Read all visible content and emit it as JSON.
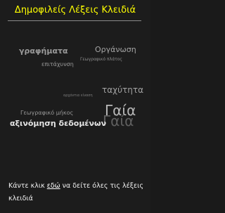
{
  "panel": {
    "title": "Δημοφιλείς Λέξεις Κλειδιά"
  },
  "tag_cloud": [
    {
      "key": "grafimata",
      "label": "γραφήματα"
    },
    {
      "key": "organosi",
      "label": "Οργάνωση"
    },
    {
      "key": "geoplatos",
      "label": "Γεωγραφικό πλάτος"
    },
    {
      "key": "epitaxynsi",
      "label": "επιτάχυνση"
    },
    {
      "key": "taxytita",
      "label": "ταχύτητα"
    },
    {
      "key": "arxontia",
      "label": "αρχόντια είναση"
    },
    {
      "key": "geomikos",
      "label": "Γεωγραφικό μήκος"
    },
    {
      "key": "gaia",
      "label": "Γαία"
    },
    {
      "key": "gaia_ghost",
      "label": "Γαία"
    },
    {
      "key": "axinomisi",
      "label": "αξινόμηση δεδομένων"
    }
  ],
  "footer": {
    "prefix": "Κάντε κλικ ",
    "link": "εδώ",
    "suffix": " να δείτε όλες τις λέξεις κλειδιά"
  },
  "colors": {
    "background": "#1c1c1c",
    "title": "#ffff00",
    "rule": "#8a8a8a"
  }
}
